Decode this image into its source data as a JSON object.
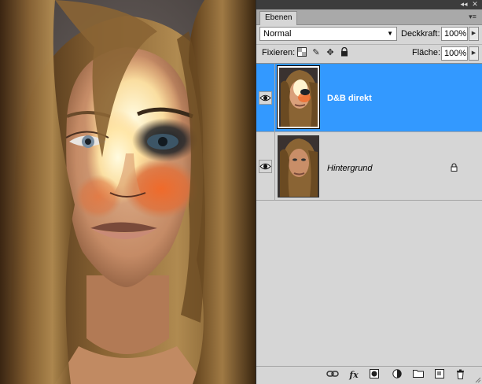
{
  "panel": {
    "tab_label": "Ebenen",
    "blend_mode": "Normal",
    "opacity_label": "Deckkraft:",
    "opacity_value": "100%",
    "lock_label": "Fixieren:",
    "fill_label": "Fläche:",
    "fill_value": "100%",
    "layers": [
      {
        "name": "D&B direkt",
        "selected": true,
        "visible": true,
        "locked": false
      },
      {
        "name": "Hintergrund",
        "selected": false,
        "visible": true,
        "locked": true
      }
    ],
    "bottom_icons": [
      "link-layers-icon",
      "fx-icon",
      "add-mask-icon",
      "adjustment-layer-icon",
      "new-group-icon",
      "new-layer-icon",
      "trash-icon"
    ],
    "lock_icons": [
      "lock-transparent-pixels-icon",
      "lock-image-pixels-icon",
      "lock-position-icon",
      "lock-all-icon"
    ]
  },
  "colors": {
    "selection": "#3399ff",
    "panel_bg": "#d6d6d6",
    "titlebar": "#3c3c3c"
  }
}
